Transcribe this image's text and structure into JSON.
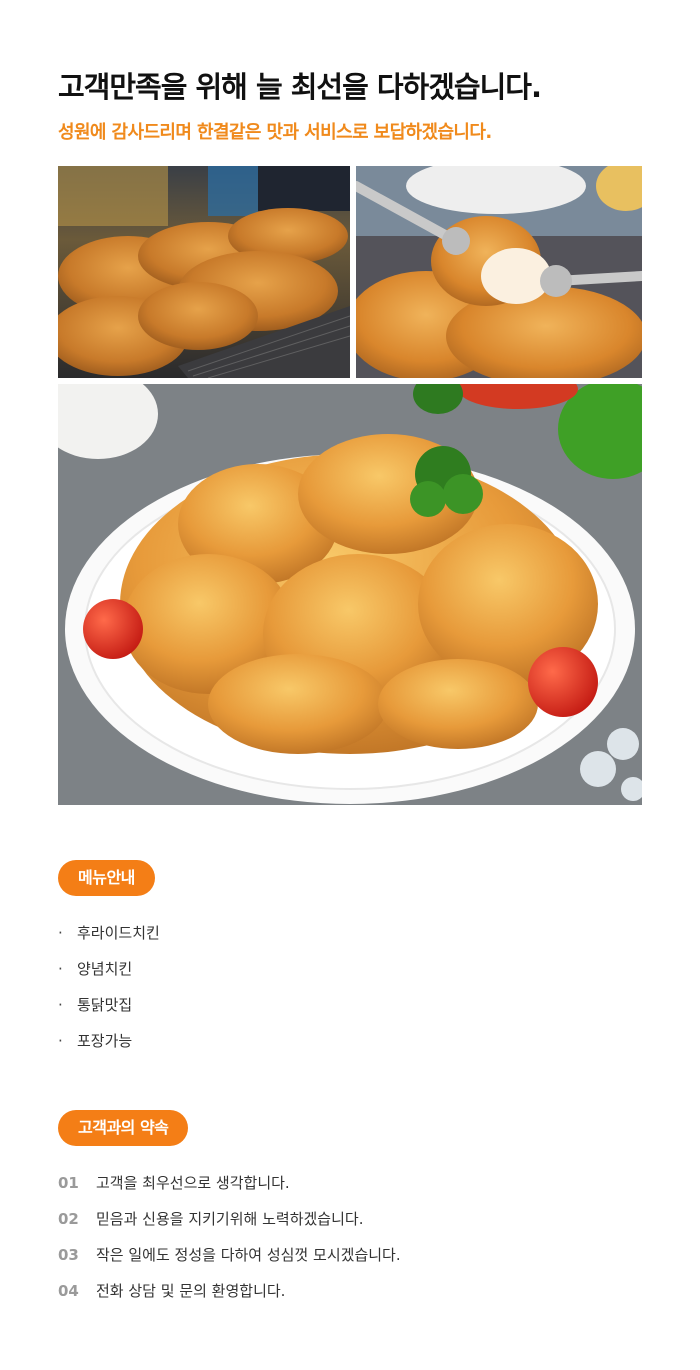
{
  "header": {
    "title": "고객만족을 위해 늘 최선을 다하겠습니다.",
    "subtitle": "성원에 감사드리며 한결같은 맛과 서비스로 보답하겠습니다."
  },
  "photos": [
    {
      "icon": "fried-chicken-tray-photo"
    },
    {
      "icon": "chicken-with-tongs-photo"
    },
    {
      "icon": "chicken-platter-photo"
    }
  ],
  "menu": {
    "heading": "메뉴안내",
    "bullet": "·",
    "items": [
      "후라이드치킨",
      "양념치킨",
      "통닭맛집",
      "포장가능"
    ]
  },
  "promise": {
    "heading": "고객과의 약속",
    "items": [
      {
        "num": "01",
        "text": "고객을 최우선으로 생각합니다."
      },
      {
        "num": "02",
        "text": "믿음과 신용을 지키기위해 노력하겠습니다."
      },
      {
        "num": "03",
        "text": "작은 일에도 정성을 다하여 성심껏 모시겠습니다."
      },
      {
        "num": "04",
        "text": "전화 상담 및 문의 환영합니다."
      }
    ]
  },
  "colors": {
    "accent": "#f47e16",
    "subtitle": "#f08a1c",
    "number": "#9a9a9a"
  }
}
